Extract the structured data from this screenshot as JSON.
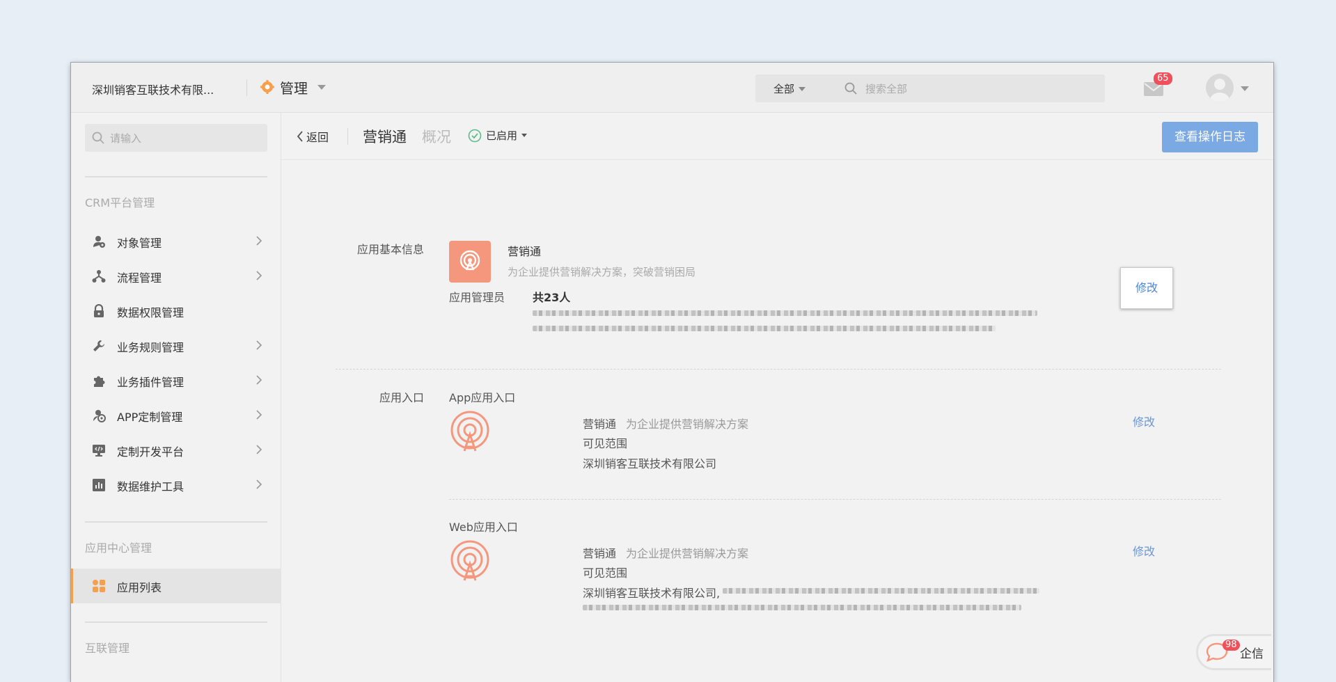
{
  "header": {
    "company": "深圳销客互联技术有限...",
    "module_title": "管理",
    "scope": "全部",
    "search_placeholder": "搜索全部",
    "mail_badge": "65"
  },
  "sidebar": {
    "search_placeholder": "请输入",
    "sections": [
      {
        "title": "CRM平台管理",
        "items": [
          {
            "label": "对象管理",
            "icon": "object-icon"
          },
          {
            "label": "流程管理",
            "icon": "flow-icon"
          },
          {
            "label": "数据权限管理",
            "icon": "lock-icon"
          },
          {
            "label": "业务规则管理",
            "icon": "wrench-icon"
          },
          {
            "label": "业务插件管理",
            "icon": "puzzle-icon"
          },
          {
            "label": "APP定制管理",
            "icon": "app-custom-icon"
          },
          {
            "label": "定制开发平台",
            "icon": "dev-icon"
          },
          {
            "label": "数据维护工具",
            "icon": "chart-icon"
          }
        ]
      },
      {
        "title": "应用中心管理",
        "items": [
          {
            "label": "应用列表",
            "icon": "grid-icon"
          }
        ]
      },
      {
        "title": "互联管理",
        "items": []
      }
    ]
  },
  "toolbar": {
    "back_label": "返回",
    "app_name": "营销通",
    "overview": "概况",
    "status": "已启用",
    "log_button": "查看操作日志"
  },
  "basic_info": {
    "label": "应用基本信息",
    "app_name": "营销通",
    "description": "为企业提供营销解决方案，突破营销困局",
    "admin_label": "应用管理员",
    "admin_count": "共23人",
    "edit_label": "修改"
  },
  "entries": {
    "label": "应用入口",
    "app": {
      "title": "App应用入口",
      "name": "营销通",
      "description": "为企业提供营销解决方案",
      "scope_label": "可见范围",
      "scope_value": "深圳销客互联技术有限公司",
      "edit_label": "修改"
    },
    "web": {
      "title": "Web应用入口",
      "name": "营销通",
      "description": "为企业提供营销解决方案",
      "scope_label": "可见范围",
      "scope_value": "深圳销客互联技术有限公司,",
      "edit_label": "修改"
    }
  },
  "chat": {
    "badge": "98",
    "label": "企信"
  },
  "colors": {
    "accent_blue": "#7aa9e3",
    "link_blue": "#6a96d4",
    "app_icon": "#f4977d",
    "badge_red": "#f0505a",
    "active_marker": "#f6a04d"
  }
}
